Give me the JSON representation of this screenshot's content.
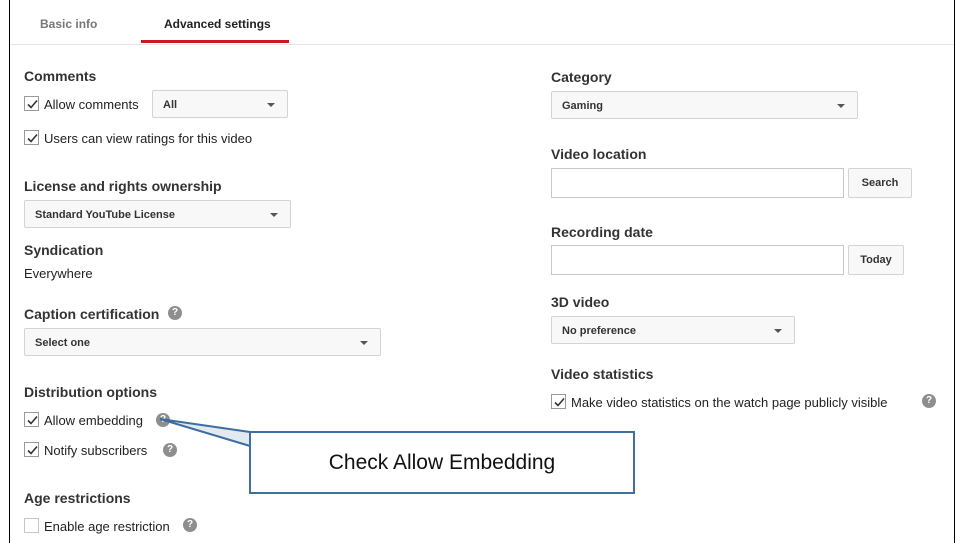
{
  "tabs": [
    {
      "label": "Basic info"
    },
    {
      "label": "Advanced settings"
    }
  ],
  "comments": {
    "heading": "Comments",
    "allow_comments_label": "Allow comments",
    "allow_comments_checked": true,
    "allow_comments_select": "All",
    "ratings_label": "Users can view ratings for this video",
    "ratings_checked": true
  },
  "license": {
    "heading": "License and rights ownership",
    "select": "Standard YouTube License"
  },
  "syndication": {
    "heading": "Syndication",
    "value": "Everywhere"
  },
  "caption": {
    "heading": "Caption certification",
    "select": "Select one"
  },
  "distribution": {
    "heading": "Distribution options",
    "allow_embedding_label": "Allow embedding",
    "allow_embedding_checked": true,
    "notify_label": "Notify subscribers",
    "notify_checked": true
  },
  "age": {
    "heading": "Age restrictions",
    "enable_label": "Enable age restriction",
    "enable_checked": false
  },
  "category": {
    "heading": "Category",
    "select": "Gaming"
  },
  "location": {
    "heading": "Video location",
    "value": "",
    "button": "Search"
  },
  "recording": {
    "heading": "Recording date",
    "value": "",
    "button": "Today"
  },
  "video3d": {
    "heading": "3D video",
    "select": "No preference"
  },
  "stats": {
    "heading": "Video statistics",
    "label": "Make video statistics on the watch page publicly visible",
    "checked": true
  },
  "help_glyph": "?",
  "callout": {
    "text": "Check Allow Embedding",
    "border_color": "#3f6ea0"
  },
  "colors": {
    "active_tab_underline": "#cc181e",
    "help_icon": "#8e8e8e"
  }
}
